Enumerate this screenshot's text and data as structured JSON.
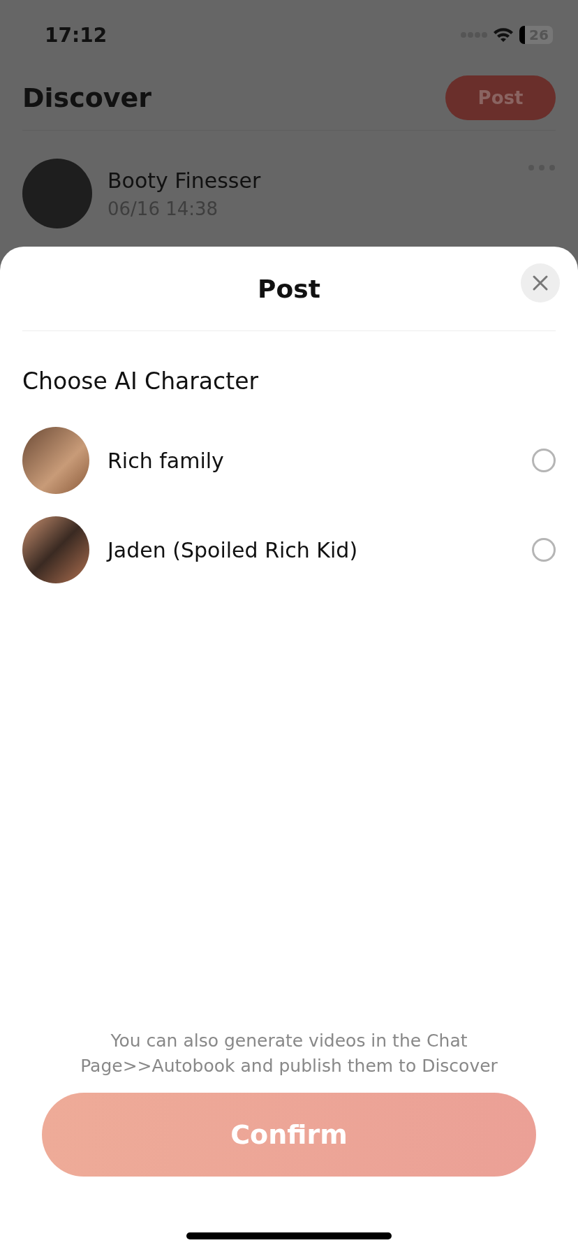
{
  "status_bar": {
    "time": "17:12",
    "battery": "26"
  },
  "background_page": {
    "title": "Discover",
    "post_button": "Post",
    "feed": [
      {
        "name": "Booty Finesser",
        "time": "06/16 14:38"
      }
    ]
  },
  "sheet": {
    "title": "Post",
    "section_title": "Choose AI Character",
    "characters": [
      {
        "name": "Rich family",
        "selected": false
      },
      {
        "name": "Jaden (Spoiled Rich Kid)",
        "selected": false
      }
    ],
    "hint": "You can also generate videos in the Chat Page>>Autobook and publish them to Discover",
    "confirm_button": {
      "label": "Confirm",
      "disabled": true
    }
  }
}
